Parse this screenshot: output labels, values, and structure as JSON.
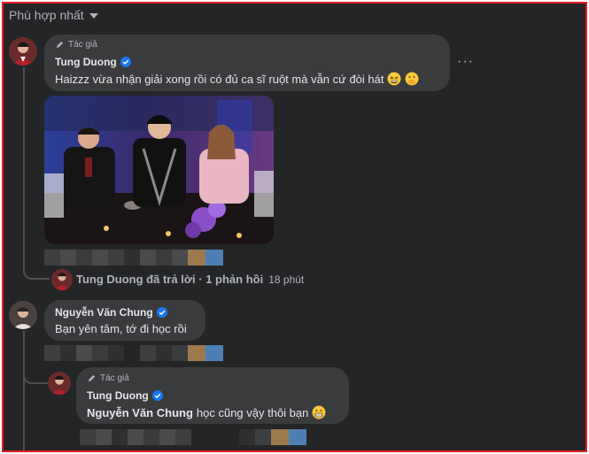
{
  "sort": {
    "label": "Phù hợp nhất"
  },
  "comments": [
    {
      "author_badge": "Tác giả",
      "author": "Tung Duong",
      "text": "Haizzz vừa nhận giải xong rồi có đủ ca sĩ ruột mà vẫn cứ đòi hát",
      "emojis": [
        "tired-face-emoji",
        "hand-over-mouth-emoji"
      ],
      "more_label": "···"
    }
  ],
  "reply_summary": {
    "text": "Tung Duong đã trả lời · 1 phản hồi",
    "time": "18 phút"
  },
  "reply1": {
    "author": "Nguyễn Văn Chung",
    "text": "Bạn yên tâm, tớ đi học rồi"
  },
  "reply2": {
    "author_badge": "Tác giả",
    "author": "Tung Duong",
    "mention": "Nguyễn Văn Chung",
    "text": "học cũng vậy thôi bạn",
    "emoji": "grimace-emoji"
  },
  "colors": {
    "background": "#242526",
    "bubble": "#3a3b3c",
    "verified": "#1877f2",
    "frame": "#e41e26"
  }
}
